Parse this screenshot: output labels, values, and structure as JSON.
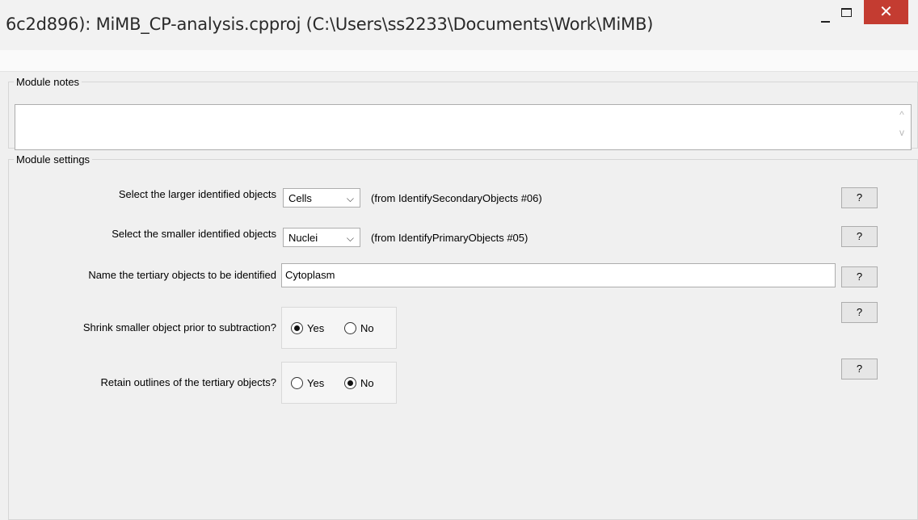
{
  "window": {
    "title": "6c2d896): MiMB_CP-analysis.cpproj (C:\\Users\\ss2233\\Documents\\Work\\MiMB)",
    "close_glyph": "✕",
    "accent_close": "#c43c31"
  },
  "module_notes": {
    "label": "Module notes",
    "value": "",
    "scroll_up": "^",
    "scroll_down": "v"
  },
  "module_settings": {
    "label": "Module settings",
    "help_label": "?",
    "settings": [
      {
        "label": "Select the larger identified objects",
        "control": "select",
        "value": "Cells",
        "source": "(from IdentifySecondaryObjects #06)"
      },
      {
        "label": "Select the smaller identified objects",
        "control": "select",
        "value": "Nuclei",
        "source": "(from IdentifyPrimaryObjects #05)"
      },
      {
        "label": "Name the tertiary objects to be identified",
        "control": "text",
        "value": "Cytoplasm"
      },
      {
        "label": "Shrink smaller object prior to subtraction?",
        "control": "radio",
        "options": [
          "Yes",
          "No"
        ],
        "selected": "Yes"
      },
      {
        "label": "Retain outlines of the tertiary objects?",
        "control": "radio",
        "options": [
          "Yes",
          "No"
        ],
        "selected": "No"
      }
    ]
  }
}
